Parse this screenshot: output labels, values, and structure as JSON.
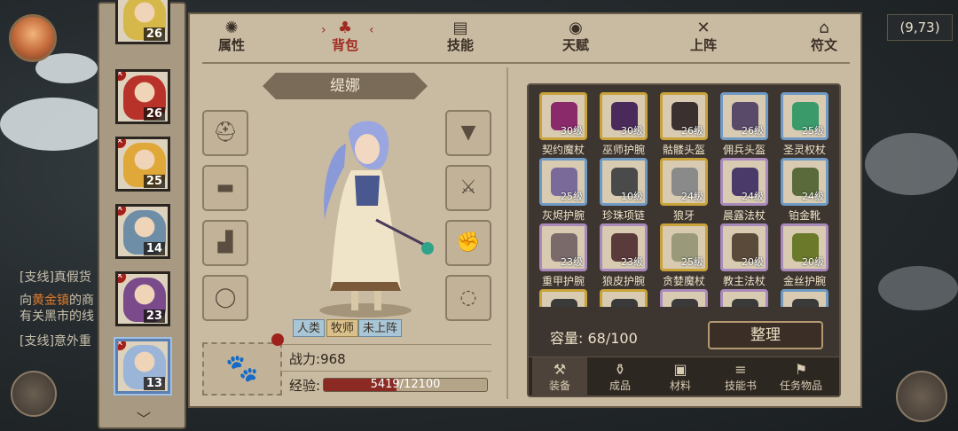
{
  "world": {
    "coords": "(9,73)",
    "quest_lines": [
      {
        "text": "[支线]真假货"
      },
      {
        "pre": "向",
        "hl": "黄金镇",
        "post": "的商"
      },
      {
        "text": "有关黑市的线"
      },
      {
        "text": "[支线]意外重"
      }
    ]
  },
  "heroes": [
    {
      "level": "26",
      "color": "#d6b84a"
    },
    {
      "level": "26",
      "color": "#b8322a"
    },
    {
      "level": "25",
      "color": "#e0a838"
    },
    {
      "level": "14",
      "color": "#6e8ea8"
    },
    {
      "level": "23",
      "color": "#7a4a8a"
    },
    {
      "level": "13",
      "color": "#9bb5d8"
    }
  ],
  "tabs": [
    {
      "label": "属性",
      "icon": "flame-icon",
      "glyph": "✺"
    },
    {
      "label": "背包",
      "icon": "bag-icon",
      "glyph": "♣"
    },
    {
      "label": "技能",
      "icon": "book-icon",
      "glyph": "▤"
    },
    {
      "label": "天赋",
      "icon": "eye-icon",
      "glyph": "◉"
    },
    {
      "label": "上阵",
      "icon": "swords-icon",
      "glyph": "✕"
    },
    {
      "label": "符文",
      "icon": "rune-icon",
      "glyph": "⌂"
    }
  ],
  "character": {
    "name": "缇娜",
    "tags": [
      "人类",
      "牧师",
      "未上阵"
    ],
    "power_label": "战力:",
    "power": "968",
    "exp_label": "经验:",
    "exp_text": "5419/12100",
    "exp_fraction": 0.448
  },
  "slots_left": [
    "helmet-slot",
    "belt-slot",
    "boots-slot",
    "ring-slot"
  ],
  "slots_right": [
    "armor-slot",
    "weapon-slot",
    "gloves-slot",
    "necklace-slot"
  ],
  "inventory": {
    "items": [
      {
        "name": "契约魔杖",
        "level": "30级",
        "rarity": "gold",
        "color": "#8a2a6a"
      },
      {
        "name": "巫师护腕",
        "level": "30级",
        "rarity": "gold",
        "color": "#4a2a5a"
      },
      {
        "name": "骷髅头盔",
        "level": "26级",
        "rarity": "gold",
        "color": "#3a3030"
      },
      {
        "name": "佣兵头盔",
        "level": "26级",
        "rarity": "blue",
        "color": "#5a4a6a"
      },
      {
        "name": "圣灵权杖",
        "level": "25级",
        "rarity": "blue",
        "color": "#3a9a6a"
      },
      {
        "name": "灰烬护腕",
        "level": "25级",
        "rarity": "blue",
        "color": "#7a6a9a"
      },
      {
        "name": "珍珠项链",
        "level": "10级",
        "rarity": "blue",
        "color": "#4a4a4a"
      },
      {
        "name": "狼牙",
        "level": "24级",
        "rarity": "gold",
        "color": "#8a8a8a"
      },
      {
        "name": "晨露法杖",
        "level": "24级",
        "rarity": "purple",
        "color": "#4a3a6a"
      },
      {
        "name": "铂金靴",
        "level": "24级",
        "rarity": "blue",
        "color": "#5a6a3a"
      },
      {
        "name": "重甲护腕",
        "level": "23级",
        "rarity": "purple",
        "color": "#7a6a6a"
      },
      {
        "name": "狼皮护腕",
        "level": "23级",
        "rarity": "purple",
        "color": "#5a3a3a"
      },
      {
        "name": "贪婪魔杖",
        "level": "25级",
        "rarity": "gold",
        "color": "#9a9a7a"
      },
      {
        "name": "教主法杖",
        "level": "20级",
        "rarity": "purple",
        "color": "#5a4a3a"
      },
      {
        "name": "金丝护腕",
        "level": "20级",
        "rarity": "purple",
        "color": "#6a7a2a"
      },
      {
        "name": "",
        "level": "",
        "rarity": "gold",
        "color": "#3a3a3a"
      },
      {
        "name": "",
        "level": "",
        "rarity": "gold",
        "color": "#3a3a3a"
      },
      {
        "name": "",
        "level": "",
        "rarity": "purple",
        "color": "#3a3a3a"
      },
      {
        "name": "",
        "level": "",
        "rarity": "purple",
        "color": "#3a3a3a"
      },
      {
        "name": "",
        "level": "",
        "rarity": "blue",
        "color": "#3a3a3a"
      }
    ],
    "capacity_label": "容量:",
    "capacity": "68/100",
    "tidy_label": "整理",
    "categories": [
      {
        "label": "装备",
        "icon": "hammer-icon",
        "glyph": "⚒"
      },
      {
        "label": "成品",
        "icon": "bottle-icon",
        "glyph": "⚱"
      },
      {
        "label": "材料",
        "icon": "material-icon",
        "glyph": "▣"
      },
      {
        "label": "技能书",
        "icon": "scroll-icon",
        "glyph": "≡"
      },
      {
        "label": "任务物品",
        "icon": "quest-icon",
        "glyph": "⚑"
      }
    ]
  }
}
